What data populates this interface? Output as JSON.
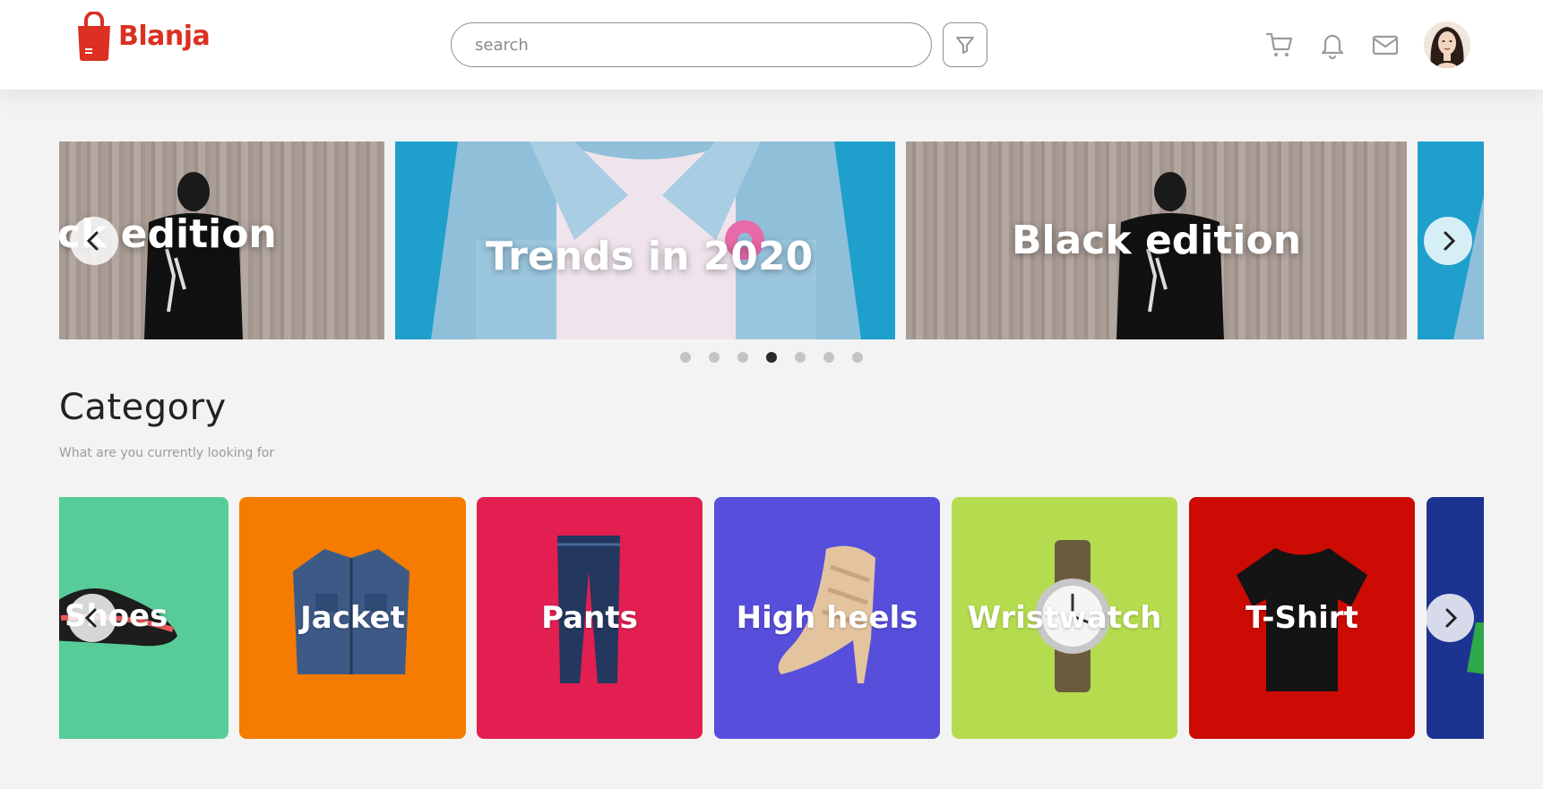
{
  "brand": {
    "name": "Blanja",
    "color": "#DB3022"
  },
  "search": {
    "placeholder": "search"
  },
  "header_icons": [
    "cart-icon",
    "bell-icon",
    "mail-icon",
    "filter-icon"
  ],
  "banners": [
    {
      "title": "Black edition",
      "visible_text": "ck edition"
    },
    {
      "title": "Trends in 2020"
    },
    {
      "title": "Black edition"
    }
  ],
  "carousel_dots": {
    "count": 7,
    "active_index": 3
  },
  "category": {
    "title": "Category",
    "subtitle": "What are you currently looking for",
    "items": [
      {
        "label": "Shoes",
        "color": "#57CC99"
      },
      {
        "label": "Jacket",
        "color": "#F57C00"
      },
      {
        "label": "Pants",
        "color": "#E31F51"
      },
      {
        "label": "High heels",
        "color": "#574FDC"
      },
      {
        "label": "Wristwatch",
        "color": "#B5DC4F"
      },
      {
        "label": "T-Shirt",
        "color": "#CC0B04"
      },
      {
        "label": "",
        "color": "#1C3391"
      }
    ]
  }
}
